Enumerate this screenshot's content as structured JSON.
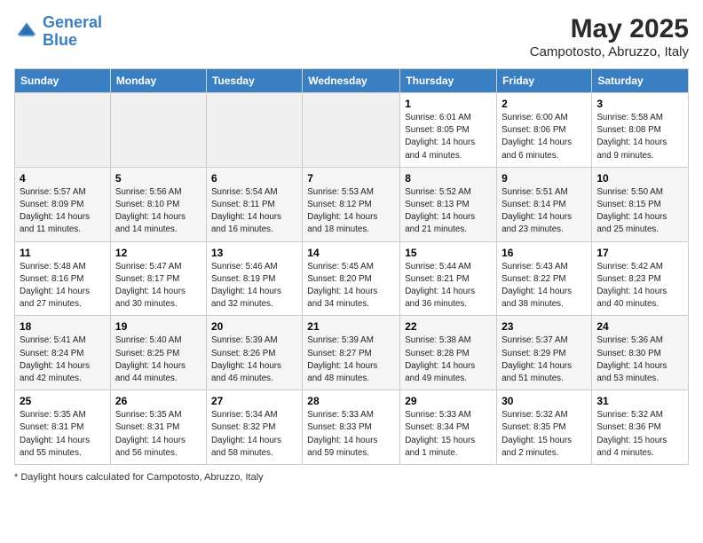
{
  "logo": {
    "line1": "General",
    "line2": "Blue"
  },
  "title": "May 2025",
  "location": "Campotosto, Abruzzo, Italy",
  "weekdays": [
    "Sunday",
    "Monday",
    "Tuesday",
    "Wednesday",
    "Thursday",
    "Friday",
    "Saturday"
  ],
  "footer": "Daylight hours",
  "weeks": [
    [
      {
        "day": "",
        "info": ""
      },
      {
        "day": "",
        "info": ""
      },
      {
        "day": "",
        "info": ""
      },
      {
        "day": "",
        "info": ""
      },
      {
        "day": "1",
        "info": "Sunrise: 6:01 AM\nSunset: 8:05 PM\nDaylight: 14 hours\nand 4 minutes."
      },
      {
        "day": "2",
        "info": "Sunrise: 6:00 AM\nSunset: 8:06 PM\nDaylight: 14 hours\nand 6 minutes."
      },
      {
        "day": "3",
        "info": "Sunrise: 5:58 AM\nSunset: 8:08 PM\nDaylight: 14 hours\nand 9 minutes."
      }
    ],
    [
      {
        "day": "4",
        "info": "Sunrise: 5:57 AM\nSunset: 8:09 PM\nDaylight: 14 hours\nand 11 minutes."
      },
      {
        "day": "5",
        "info": "Sunrise: 5:56 AM\nSunset: 8:10 PM\nDaylight: 14 hours\nand 14 minutes."
      },
      {
        "day": "6",
        "info": "Sunrise: 5:54 AM\nSunset: 8:11 PM\nDaylight: 14 hours\nand 16 minutes."
      },
      {
        "day": "7",
        "info": "Sunrise: 5:53 AM\nSunset: 8:12 PM\nDaylight: 14 hours\nand 18 minutes."
      },
      {
        "day": "8",
        "info": "Sunrise: 5:52 AM\nSunset: 8:13 PM\nDaylight: 14 hours\nand 21 minutes."
      },
      {
        "day": "9",
        "info": "Sunrise: 5:51 AM\nSunset: 8:14 PM\nDaylight: 14 hours\nand 23 minutes."
      },
      {
        "day": "10",
        "info": "Sunrise: 5:50 AM\nSunset: 8:15 PM\nDaylight: 14 hours\nand 25 minutes."
      }
    ],
    [
      {
        "day": "11",
        "info": "Sunrise: 5:48 AM\nSunset: 8:16 PM\nDaylight: 14 hours\nand 27 minutes."
      },
      {
        "day": "12",
        "info": "Sunrise: 5:47 AM\nSunset: 8:17 PM\nDaylight: 14 hours\nand 30 minutes."
      },
      {
        "day": "13",
        "info": "Sunrise: 5:46 AM\nSunset: 8:19 PM\nDaylight: 14 hours\nand 32 minutes."
      },
      {
        "day": "14",
        "info": "Sunrise: 5:45 AM\nSunset: 8:20 PM\nDaylight: 14 hours\nand 34 minutes."
      },
      {
        "day": "15",
        "info": "Sunrise: 5:44 AM\nSunset: 8:21 PM\nDaylight: 14 hours\nand 36 minutes."
      },
      {
        "day": "16",
        "info": "Sunrise: 5:43 AM\nSunset: 8:22 PM\nDaylight: 14 hours\nand 38 minutes."
      },
      {
        "day": "17",
        "info": "Sunrise: 5:42 AM\nSunset: 8:23 PM\nDaylight: 14 hours\nand 40 minutes."
      }
    ],
    [
      {
        "day": "18",
        "info": "Sunrise: 5:41 AM\nSunset: 8:24 PM\nDaylight: 14 hours\nand 42 minutes."
      },
      {
        "day": "19",
        "info": "Sunrise: 5:40 AM\nSunset: 8:25 PM\nDaylight: 14 hours\nand 44 minutes."
      },
      {
        "day": "20",
        "info": "Sunrise: 5:39 AM\nSunset: 8:26 PM\nDaylight: 14 hours\nand 46 minutes."
      },
      {
        "day": "21",
        "info": "Sunrise: 5:39 AM\nSunset: 8:27 PM\nDaylight: 14 hours\nand 48 minutes."
      },
      {
        "day": "22",
        "info": "Sunrise: 5:38 AM\nSunset: 8:28 PM\nDaylight: 14 hours\nand 49 minutes."
      },
      {
        "day": "23",
        "info": "Sunrise: 5:37 AM\nSunset: 8:29 PM\nDaylight: 14 hours\nand 51 minutes."
      },
      {
        "day": "24",
        "info": "Sunrise: 5:36 AM\nSunset: 8:30 PM\nDaylight: 14 hours\nand 53 minutes."
      }
    ],
    [
      {
        "day": "25",
        "info": "Sunrise: 5:35 AM\nSunset: 8:31 PM\nDaylight: 14 hours\nand 55 minutes."
      },
      {
        "day": "26",
        "info": "Sunrise: 5:35 AM\nSunset: 8:31 PM\nDaylight: 14 hours\nand 56 minutes."
      },
      {
        "day": "27",
        "info": "Sunrise: 5:34 AM\nSunset: 8:32 PM\nDaylight: 14 hours\nand 58 minutes."
      },
      {
        "day": "28",
        "info": "Sunrise: 5:33 AM\nSunset: 8:33 PM\nDaylight: 14 hours\nand 59 minutes."
      },
      {
        "day": "29",
        "info": "Sunrise: 5:33 AM\nSunset: 8:34 PM\nDaylight: 15 hours\nand 1 minute."
      },
      {
        "day": "30",
        "info": "Sunrise: 5:32 AM\nSunset: 8:35 PM\nDaylight: 15 hours\nand 2 minutes."
      },
      {
        "day": "31",
        "info": "Sunrise: 5:32 AM\nSunset: 8:36 PM\nDaylight: 15 hours\nand 4 minutes."
      }
    ]
  ]
}
